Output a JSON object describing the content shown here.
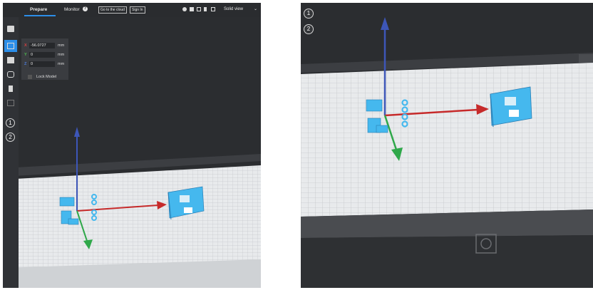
{
  "left_view": {
    "topbar": {
      "tab_prepare": "Prepare",
      "tab_monitor": "Monitor",
      "btn_cloud": "Go to the cloud",
      "btn_signin": "Sign In",
      "view_mode": "Solid view",
      "accent_color": "#2c8ee8"
    },
    "sidebar": {
      "tools": [
        "open-folder-icon",
        "move-icon",
        "scale-icon",
        "rotate-icon",
        "mirror-icon",
        "support-icon"
      ],
      "active_tool": "move-icon",
      "badges": [
        "1",
        "2"
      ]
    },
    "transform_panel": {
      "x": {
        "axis": "X",
        "value": "-56.0727",
        "unit": "mm"
      },
      "y": {
        "axis": "Y",
        "value": "0",
        "unit": "mm"
      },
      "z": {
        "axis": "Z",
        "value": "0",
        "unit": "mm"
      },
      "lock_label": "Lock Model"
    }
  },
  "right_view": {
    "badges": [
      "1",
      "2"
    ]
  },
  "colors": {
    "model": "#45b8ee",
    "x_axis": "#c62a2a",
    "y_axis": "#2fa84a",
    "z_axis": "#3d56b8",
    "build_plate": "#e8eaec"
  }
}
